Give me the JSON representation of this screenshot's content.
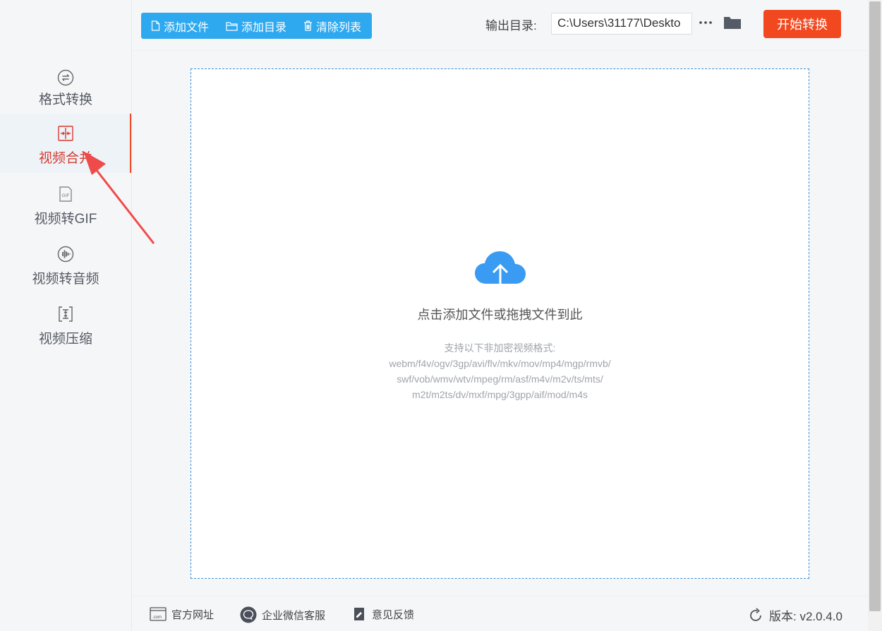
{
  "sidebar": {
    "items": [
      {
        "label": "格式转换",
        "icon": "format-convert-icon"
      },
      {
        "label": "视频合并",
        "icon": "video-merge-icon",
        "active": true
      },
      {
        "label": "视频转GIF",
        "icon": "gif-icon"
      },
      {
        "label": "视频转音频",
        "icon": "audio-icon"
      },
      {
        "label": "视频压缩",
        "icon": "compress-icon"
      }
    ]
  },
  "toolbar": {
    "add_file": "添加文件",
    "add_dir": "添加目录",
    "clear_list": "清除列表"
  },
  "output": {
    "label": "输出目录:",
    "path": "C:\\Users\\31177\\Deskto",
    "start_button": "开始转换"
  },
  "dropzone": {
    "title": "点击添加文件或拖拽文件到此",
    "formats_heading": "支持以下非加密视频格式:",
    "formats_line1": "webm/f4v/ogv/3gp/avi/flv/mkv/mov/mp4/mgp/rmvb/",
    "formats_line2": "swf/vob/wmv/wtv/mpeg/rm/asf/m4v/m2v/ts/mts/",
    "formats_line3": "m2t/m2ts/dv/mxf/mpg/3gpp/aif/mod/m4s"
  },
  "footer": {
    "website": "官方网址",
    "wechat": "企业微信客服",
    "feedback": "意见反馈",
    "version": "版本:  v2.0.4.0"
  },
  "colors": {
    "accent_blue": "#2ea9f0",
    "start_red": "#f14820",
    "active_red": "#d63a2f",
    "annotation_red": "#ef4b4b"
  }
}
